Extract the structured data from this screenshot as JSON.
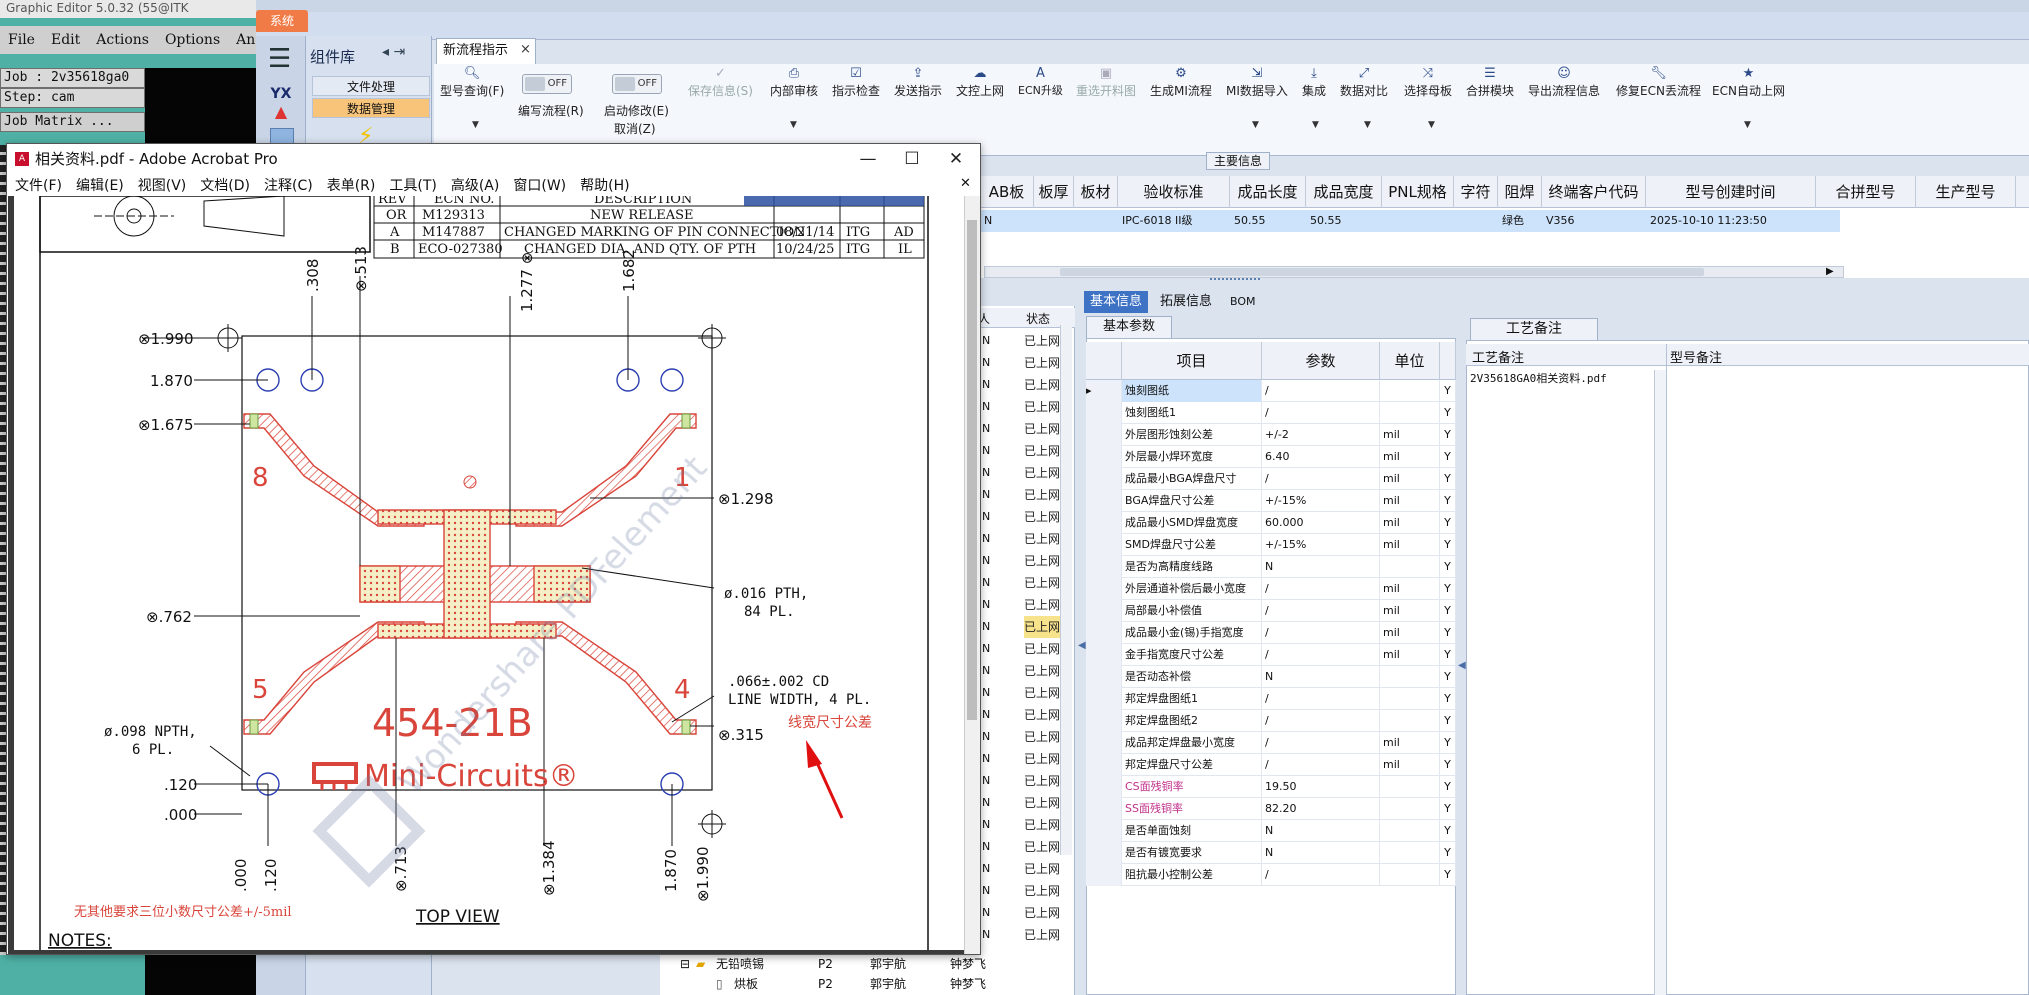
{
  "graphic_editor": {
    "title": "Graphic Editor 5.0.32 (55@ITK",
    "menu": [
      "File",
      "Edit",
      "Actions",
      "Options",
      "Analy"
    ],
    "job_label": "Job : 2v35618ga0",
    "step_label": "Step: cam",
    "job_matrix": "Job Matrix ..."
  },
  "app": {
    "system_tab": "系统",
    "component_panel": {
      "title": "组件库",
      "items": [
        "文件处理",
        "数据管理"
      ]
    },
    "flow_tab": "新流程指示",
    "ribbon": {
      "buttons": [
        {
          "label": "型号查询(F)",
          "icon": "search-icon"
        },
        {
          "label": "编写流程(R)",
          "icon": "toggle-off"
        },
        {
          "label": "启动修改(E)",
          "icon": "toggle-off"
        },
        {
          "label": "保存信息(S)",
          "icon": "check-icon"
        },
        {
          "label": "内部审核",
          "icon": "print-icon"
        },
        {
          "label": "指示检查",
          "icon": "check-box-icon"
        },
        {
          "label": "发送指示",
          "icon": "upload-icon"
        },
        {
          "label": "文控上网",
          "icon": "cloud-upload-icon"
        },
        {
          "label": "ECN升级",
          "icon": "ecn-icon"
        },
        {
          "label": "重选开料图",
          "icon": "image-icon"
        },
        {
          "label": "生成MI流程",
          "icon": "gears-icon"
        },
        {
          "label": "MI数据导入",
          "icon": "import-icon"
        },
        {
          "label": "集成",
          "icon": "download-icon"
        },
        {
          "label": "数据对比",
          "icon": "compare-icon"
        },
        {
          "label": "选择母板",
          "icon": "shuffle-icon"
        },
        {
          "label": "合拼模块",
          "icon": "list-icon"
        },
        {
          "label": "导出流程信息",
          "icon": "smile-icon"
        },
        {
          "label": "修复ECN丢流程",
          "icon": "wrench-icon"
        },
        {
          "label": "ECN自动上网",
          "icon": "star-icon"
        }
      ],
      "toggle_text": "OFF",
      "cancel_label": "取消(Z)"
    },
    "main_info_label": "主要信息",
    "upper_grid": {
      "headers": [
        "AB板",
        "板厚",
        "板材",
        "验收标准",
        "成品长度",
        "成品宽度",
        "PNL规格",
        "字符",
        "阻焊",
        "终端客户代码",
        "型号创建时间"
      ],
      "right_headers": [
        "合拼型号",
        "生产型号"
      ],
      "row": [
        "N",
        "",
        "",
        "IPC-6018 II级",
        "50.55",
        "50.55",
        "",
        "",
        "绿色",
        "V356",
        "2025-10-10 11:23:50"
      ]
    },
    "status_column": {
      "header_left": "人",
      "header": "状态",
      "value": "已上网"
    },
    "basic_info": {
      "tabs": [
        "基本信息",
        "拓展信息",
        "BOM"
      ],
      "sub_tab": "基本参数",
      "headers": [
        "项目",
        "参数",
        "单位"
      ],
      "rows": [
        {
          "item": "蚀刻图纸",
          "param": "/",
          "unit": "",
          "flag": "Y"
        },
        {
          "item": "蚀刻图纸1",
          "param": "/",
          "unit": "",
          "flag": "Y"
        },
        {
          "item": "外层图形蚀刻公差",
          "param": "+/-2",
          "unit": "mil",
          "flag": "Y"
        },
        {
          "item": "外层最小焊环宽度",
          "param": "6.40",
          "unit": "mil",
          "flag": "Y"
        },
        {
          "item": "成品最小BGA焊盘尺寸",
          "param": "/",
          "unit": "mil",
          "flag": "Y"
        },
        {
          "item": "BGA焊盘尺寸公差",
          "param": "+/-15%",
          "unit": "mil",
          "flag": "Y"
        },
        {
          "item": "成品最小SMD焊盘宽度",
          "param": "60.000",
          "unit": "mil",
          "flag": "Y"
        },
        {
          "item": "SMD焊盘尺寸公差",
          "param": "+/-15%",
          "unit": "mil",
          "flag": "Y"
        },
        {
          "item": "是否为高精度线路",
          "param": "N",
          "unit": "",
          "flag": "Y"
        },
        {
          "item": "外层通道补偿后最小宽度",
          "param": "/",
          "unit": "mil",
          "flag": "Y"
        },
        {
          "item": "局部最小补偿值",
          "param": "/",
          "unit": "mil",
          "flag": "Y"
        },
        {
          "item": "成品最小金(锡)手指宽度",
          "param": "/",
          "unit": "mil",
          "flag": "Y"
        },
        {
          "item": "金手指宽度尺寸公差",
          "param": "/",
          "unit": "mil",
          "flag": "Y"
        },
        {
          "item": "是否动态补偿",
          "param": "N",
          "unit": "",
          "flag": "Y"
        },
        {
          "item": "邦定焊盘图纸1",
          "param": "/",
          "unit": "",
          "flag": "Y"
        },
        {
          "item": "邦定焊盘图纸2",
          "param": "/",
          "unit": "",
          "flag": "Y"
        },
        {
          "item": "成品邦定焊盘最小宽度",
          "param": "/",
          "unit": "mil",
          "flag": "Y"
        },
        {
          "item": "邦定焊盘尺寸公差",
          "param": "/",
          "unit": "mil",
          "flag": "Y"
        },
        {
          "item": "CS面残铜率",
          "param": "19.50",
          "unit": "",
          "flag": "Y"
        },
        {
          "item": "SS面残铜率",
          "param": "82.20",
          "unit": "",
          "flag": "Y"
        },
        {
          "item": "是否单面蚀刻",
          "param": "N",
          "unit": "",
          "flag": "Y"
        },
        {
          "item": "是否有镀宽要求",
          "param": "N",
          "unit": "",
          "flag": "Y"
        },
        {
          "item": "阻抗最小控制公差",
          "param": "/",
          "unit": "",
          "flag": "Y"
        }
      ]
    },
    "process_note": {
      "tab": "工艺备注",
      "headers": [
        "工艺备注",
        "型号备注"
      ],
      "value": "2V35618GA0相关资料.pdf"
    },
    "tree_rows": [
      {
        "name": "无铅喷锡",
        "code": "P2",
        "person": "郭宇航",
        "person2": "钟梦飞"
      },
      {
        "name": "烘板",
        "code": "P2",
        "person": "郭宇航",
        "person2": "钟梦飞"
      }
    ]
  },
  "acrobat": {
    "title": "相关资料.pdf - Adobe Acrobat Pro",
    "menu": [
      "文件(F)",
      "编辑(E)",
      "视图(V)",
      "文档(D)",
      "注释(C)",
      "表单(R)",
      "工具(T)",
      "高级(A)",
      "窗口(W)",
      "帮助(H)"
    ],
    "revision_table": {
      "header": [
        "REV",
        "ECN NO.",
        "DESCRIPTION"
      ],
      "rows": [
        [
          "OR",
          "M129313",
          "NEW RELEASE",
          "",
          "",
          ""
        ],
        [
          "A",
          "M147887",
          "CHANGED MARKING OF PIN CONNECTION",
          "08/21/14",
          "ITG",
          "AD"
        ],
        [
          "B",
          "ECO-027380",
          "CHANGED DIA. AND QTY. OF PTH",
          "10/24/25",
          "ITG",
          "IL"
        ]
      ]
    },
    "drawing": {
      "dims_left": [
        "⊗1.990",
        "1.870",
        "⊗1.675",
        "⊗.762",
        ".120",
        ".000"
      ],
      "dims_top": [
        ".308",
        "⊗.513",
        "1.277 ⊗",
        "1.682"
      ],
      "dims_right": [
        "⊗1.298",
        "⊗.315"
      ],
      "dims_bottom": [
        ".000",
        ".120",
        "⊗.713",
        "⊗1.384",
        "1.870",
        "⊗1.990"
      ],
      "pin_labels": [
        "8",
        "1",
        "5",
        "4"
      ],
      "pth_note": "ø.016 PTH,\n84 PL.",
      "npth_note": "ø.098 NPTH,\n6 PL.",
      "line_width_note": ".066±.002 CD\nLINE WIDTH, 4 PL.",
      "red_note": "线宽尺寸公差",
      "part_number": "454-21B",
      "brand": "Mini-Circuits®",
      "watermark": "Wondershare PDFelement",
      "tolerance_note": "无其他要求三位小数尺寸公差+/-5mil",
      "view_label": "TOP VIEW",
      "notes_label": "NOTES:"
    }
  }
}
